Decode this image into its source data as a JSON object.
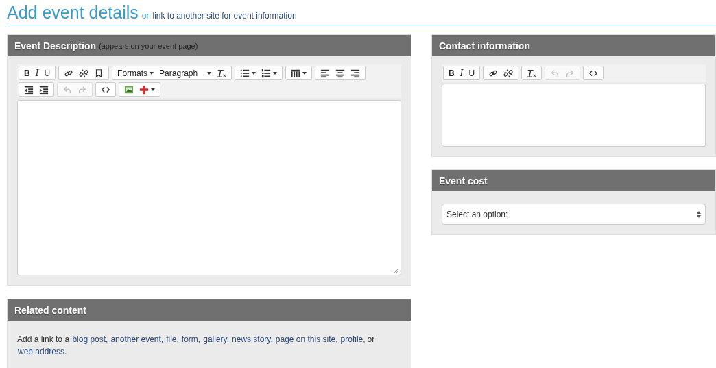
{
  "heading": {
    "title": "Add event details",
    "connector": "or",
    "link": "link to another site for event information"
  },
  "description_panel": {
    "title": "Event Description",
    "note": "(appears on your event page)",
    "toolbar_rows": [
      [
        {
          "disabled": false,
          "items": [
            {
              "kind": "bold",
              "label": "B"
            },
            {
              "kind": "italic",
              "label": "I"
            },
            {
              "kind": "underline",
              "label": "U"
            }
          ]
        },
        {
          "disabled": false,
          "items": [
            {
              "kind": "link"
            },
            {
              "kind": "unlink"
            },
            {
              "kind": "bookmark"
            }
          ]
        },
        {
          "disabled": false,
          "items": [
            {
              "kind": "menu",
              "label": "Formats"
            },
            {
              "kind": "menu-wide",
              "label": "Paragraph"
            },
            {
              "kind": "clear-format"
            }
          ]
        },
        {
          "disabled": false,
          "items": [
            {
              "kind": "bullet-list"
            },
            {
              "kind": "number-list"
            }
          ]
        },
        {
          "disabled": false,
          "items": [
            {
              "kind": "table"
            }
          ]
        },
        {
          "disabled": false,
          "items": [
            {
              "kind": "align-left"
            },
            {
              "kind": "align-center"
            },
            {
              "kind": "align-right"
            }
          ]
        }
      ],
      [
        {
          "disabled": false,
          "items": [
            {
              "kind": "outdent"
            },
            {
              "kind": "indent"
            }
          ]
        },
        {
          "disabled": true,
          "items": [
            {
              "kind": "undo"
            },
            {
              "kind": "redo"
            }
          ]
        },
        {
          "disabled": false,
          "items": [
            {
              "kind": "code"
            }
          ]
        },
        {
          "disabled": false,
          "items": [
            {
              "kind": "image"
            },
            {
              "kind": "plus"
            }
          ]
        }
      ]
    ]
  },
  "related_panel": {
    "title": "Related content",
    "intro": "Add a link to a",
    "links": [
      "blog post,",
      "another event,",
      "file,",
      "form,",
      "gallery,",
      "news story,",
      "page on this site,",
      "profile,"
    ],
    "connector": "or",
    "last_link": "web address."
  },
  "contact_panel": {
    "title": "Contact information",
    "toolbar_rows": [
      [
        {
          "disabled": false,
          "items": [
            {
              "kind": "bold",
              "label": "B"
            },
            {
              "kind": "italic",
              "label": "I"
            },
            {
              "kind": "underline",
              "label": "U"
            }
          ]
        },
        {
          "disabled": false,
          "items": [
            {
              "kind": "link"
            },
            {
              "kind": "unlink"
            }
          ]
        },
        {
          "disabled": false,
          "items": [
            {
              "kind": "clear-format"
            }
          ]
        },
        {
          "disabled": true,
          "items": [
            {
              "kind": "undo"
            },
            {
              "kind": "redo"
            }
          ]
        },
        {
          "disabled": false,
          "items": [
            {
              "kind": "code"
            }
          ]
        }
      ]
    ]
  },
  "cost_panel": {
    "title": "Event cost",
    "select": {
      "value": "Select an option:"
    }
  }
}
